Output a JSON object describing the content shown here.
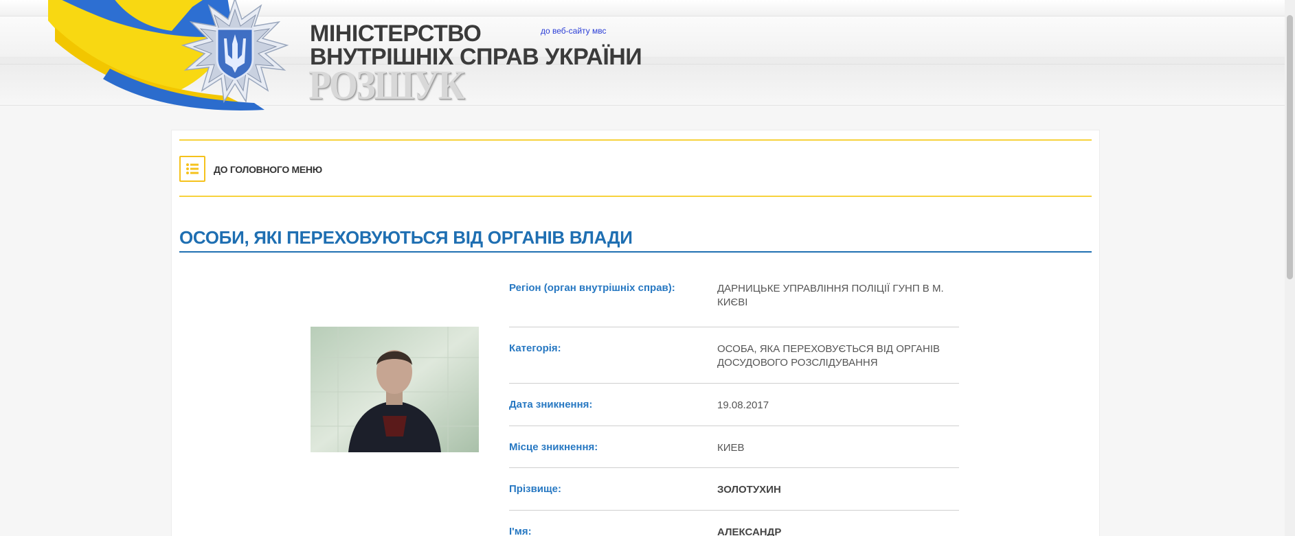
{
  "header": {
    "title_line1": "МІНІСТЕРСТВО",
    "title_line2": "ВНУТРІШНІХ СПРАВ УКРАЇНИ",
    "subtitle": "РОЗШУК",
    "site_link": "до веб-сайту мвс"
  },
  "menu": {
    "label": "ДО ГОЛОВНОГО МЕНЮ"
  },
  "section": {
    "title": "ОСОБИ, ЯКІ ПЕРЕХОВУЮТЬСЯ ВІД ОРГАНІВ ВЛАДИ"
  },
  "details": [
    {
      "label": "Регіон (орган внутрішніх справ):",
      "value": "ДАРНИЦЬКЕ УПРАВЛІННЯ ПОЛІЦІЇ ГУНП В М. КИЄВІ"
    },
    {
      "label": "Категорія:",
      "value": "ОСОБА, ЯКА ПЕРЕХОВУЄТЬСЯ ВІД ОРГАНІВ ДОСУДОВОГО РОЗСЛІДУВАННЯ"
    },
    {
      "label": "Дата зникнення:",
      "value": "19.08.2017"
    },
    {
      "label": "Місце зникнення:",
      "value": "КИЕВ"
    },
    {
      "label": "Прізвище:",
      "value": "ЗОЛОТУХИН"
    },
    {
      "label": "І'мя:",
      "value": "АЛЕКСАНДР"
    }
  ],
  "colors": {
    "accent_yellow": "#f7d23c",
    "title_blue": "#1f6fb2",
    "label_blue": "#2778c2"
  }
}
